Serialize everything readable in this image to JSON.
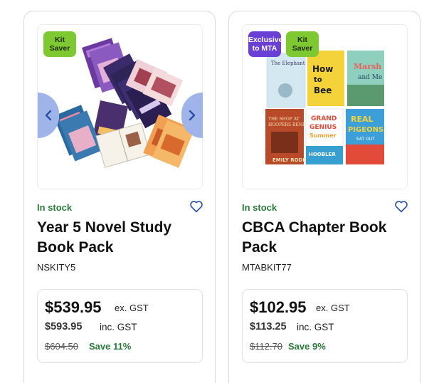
{
  "products": [
    {
      "badges": [
        {
          "label": "Kit\nSaver",
          "color": "#7ec832"
        }
      ],
      "stock": "In stock",
      "title": "Year 5 Novel Study Book Pack",
      "sku": "NSKITY5",
      "price_ex": "$539.95",
      "price_ex_suffix": "ex. GST",
      "price_inc": "$593.95",
      "price_inc_suffix": "inc. GST",
      "price_old": "$604.50",
      "save": "Save 11%"
    },
    {
      "badges": [
        {
          "label": "Exclusive\nto MTA",
          "color": "#6a3fd6"
        },
        {
          "label": "Kit\nSaver",
          "color": "#7ec832"
        }
      ],
      "stock": "In stock",
      "title": "CBCA Chapter Book Pack",
      "sku": "MTABKIT77",
      "price_ex": "$102.95",
      "price_ex_suffix": "ex. GST",
      "price_inc": "$113.25",
      "price_inc_suffix": "inc. GST",
      "price_old": "$112.70",
      "save": "Save 9%"
    }
  ],
  "book_covers_card2": [
    {
      "text": "The Elephant",
      "color": "#cfe6f2"
    },
    {
      "text": "How to Bee",
      "color": "#f4d23a"
    },
    {
      "text": "Marsh and Me",
      "color": "#7ec0b2"
    },
    {
      "text": "The Shop at Hoopers Bend",
      "color": "#b84a2a"
    },
    {
      "text": "The Grand Genius Summer of Henry Hoobler",
      "color": "#e24a3a"
    },
    {
      "text": "Real Pigeons Eat Out",
      "color": "#3d9fd8"
    }
  ],
  "colors": {
    "accent": "#2a4fa8",
    "stock_green": "#2a7a3a",
    "arrow": "#9fb4e8"
  }
}
